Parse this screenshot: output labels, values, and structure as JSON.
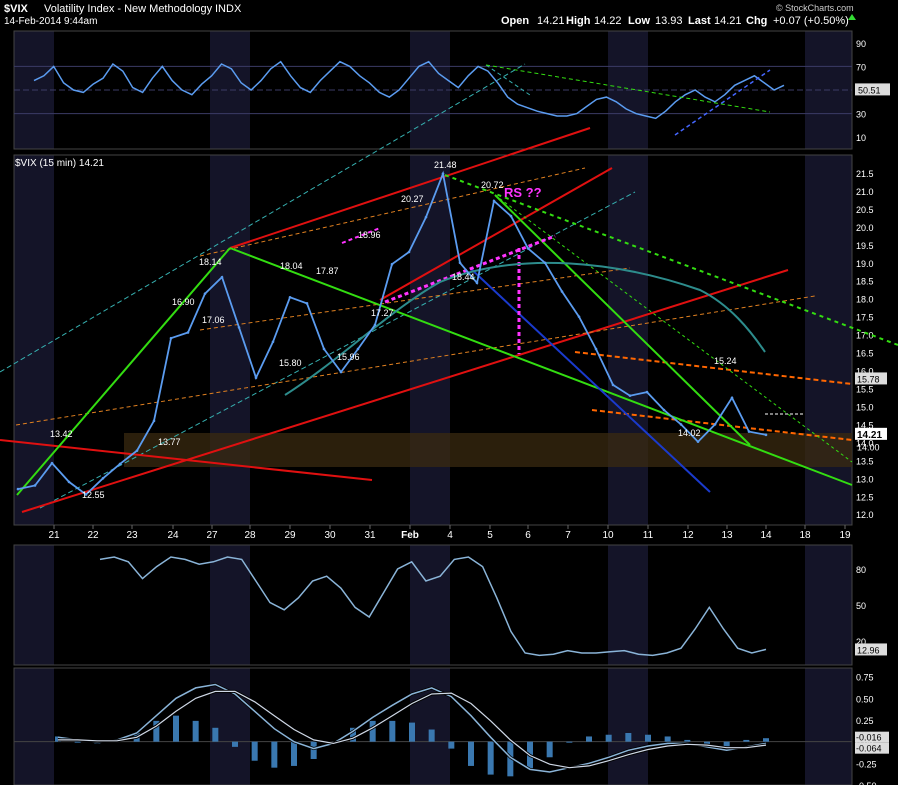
{
  "header": {
    "symbol": "$VIX",
    "name": "Volatility Index - New Methodology",
    "exchange": "INDX",
    "timestamp": "14-Feb-2014 9:44am",
    "open_label": "Open",
    "open": "14.21",
    "high_label": "High",
    "high": "14.22",
    "low_label": "Low",
    "low": "13.93",
    "last_label": "Last",
    "last": "14.21",
    "chg_label": "Chg",
    "chg": "+0.07 (+0.50%)",
    "watermark": "© StockCharts.com"
  },
  "colors": {
    "background": "#000000",
    "band": "#141428",
    "price": "#5b9cf0",
    "teal": "#36b0b0",
    "red": "#e01010",
    "green": "#33dd11",
    "orange": "#e08020",
    "magenta": "#ff33ff",
    "blue": "#1a3acc"
  },
  "chart_data": [
    {
      "type": "line",
      "panel": "indicator-top",
      "ylim": [
        0,
        100
      ],
      "y_ticks": [
        "90",
        "70",
        "50",
        "30",
        "10"
      ],
      "reference_lines": [
        70,
        50,
        30
      ],
      "current_label": "50.51",
      "current_value": 50.51,
      "series": [
        {
          "values": [
            58,
            62,
            70,
            56,
            50,
            48,
            55,
            60,
            72,
            66,
            52,
            48,
            60,
            70,
            58,
            50,
            46,
            55,
            62,
            72,
            68,
            56,
            50,
            58,
            68,
            74,
            62,
            52,
            48,
            58,
            66,
            74,
            70,
            62,
            56,
            48,
            44,
            50,
            60,
            70,
            74,
            64,
            58,
            52,
            62,
            70,
            66,
            56,
            44,
            38,
            35,
            32,
            30,
            28,
            28,
            30,
            36,
            42,
            44,
            40,
            34,
            30,
            28,
            26,
            32,
            40,
            46,
            50,
            44,
            40,
            46,
            54,
            58,
            62,
            56,
            50,
            54
          ]
        }
      ]
    },
    {
      "type": "line",
      "panel": "price",
      "title": "$VIX (15 min) 14.21",
      "ylim": [
        11.7,
        22.0
      ],
      "y_ticks": [
        "21.5",
        "21.0",
        "20.5",
        "20.0",
        "19.5",
        "19.0",
        "18.5",
        "18.0",
        "17.5",
        "17.0",
        "16.5",
        "16.0",
        "15.5",
        "15.0",
        "14.5",
        "14.0",
        "13.5",
        "13.0",
        "12.5",
        "12.0"
      ],
      "x_ticks": [
        "21",
        "22",
        "23",
        "24",
        "27",
        "28",
        "29",
        "30",
        "31",
        "Feb",
        "4",
        "5",
        "6",
        "7",
        "10",
        "11",
        "12",
        "13",
        "14",
        "18",
        "19"
      ],
      "last_label": "14.21",
      "extra_labels": [
        "15.78",
        "14.00"
      ],
      "series": [
        {
          "name": "$VIX",
          "x": [
            0,
            0.5,
            1,
            1.5,
            2,
            2.5,
            3,
            3.5,
            4,
            4.5,
            5,
            5.5,
            6,
            6.5,
            7,
            7.5,
            8,
            8.5,
            9,
            9.5,
            10,
            10.5,
            11,
            11.5,
            12,
            12.5,
            13,
            13.5,
            14,
            14.5,
            15,
            15.5,
            16,
            16.5,
            17,
            17.5,
            18,
            18.5,
            19,
            19.5,
            20,
            20.5,
            21,
            21.5,
            22
          ],
          "values": [
            12.7,
            12.8,
            13.42,
            12.9,
            12.55,
            13.0,
            13.4,
            13.77,
            14.6,
            16.9,
            17.06,
            18.14,
            18.6,
            17.2,
            15.8,
            16.8,
            18.04,
            17.87,
            16.6,
            15.96,
            16.6,
            17.27,
            18.96,
            19.3,
            20.27,
            21.48,
            19.0,
            18.44,
            20.72,
            20.3,
            19.4,
            19.0,
            18.2,
            17.5,
            16.6,
            15.6,
            15.3,
            15.4,
            14.9,
            14.5,
            14.02,
            14.5,
            15.24,
            14.3,
            14.21
          ]
        }
      ],
      "annotations": [
        "RS ??",
        "18.96",
        "21.48",
        "20.72",
        "20.27",
        "18.44",
        "17.27",
        "15.96",
        "15.80",
        "17.87",
        "18.04",
        "18.14",
        "17.06",
        "16.90",
        "13.42",
        "12.55",
        "13.77",
        "14.02",
        "15.24"
      ]
    },
    {
      "type": "line",
      "panel": "indicator-middle",
      "ylim": [
        0,
        100
      ],
      "y_ticks": [
        "80",
        "50",
        "20"
      ],
      "current_label": "12.96",
      "series": [
        {
          "values": [
            88,
            90,
            86,
            72,
            82,
            90,
            88,
            84,
            86,
            90,
            88,
            70,
            52,
            46,
            56,
            70,
            74,
            64,
            48,
            40,
            60,
            80,
            86,
            70,
            74,
            88,
            90,
            82,
            56,
            28,
            10,
            8,
            9,
            12,
            10,
            10,
            11,
            12,
            9,
            8,
            10,
            14,
            30,
            48,
            30,
            14,
            10,
            13
          ]
        }
      ]
    },
    {
      "type": "line",
      "panel": "indicator-bottom",
      "ylim": [
        -0.5,
        0.85
      ],
      "y_ticks": [
        "0.75",
        "0.50",
        "0.25",
        "0.00",
        "-0.25",
        "-0.50"
      ],
      "current_labels": [
        "-0.016",
        "-0.064"
      ],
      "series": [
        {
          "values": [
            0.05,
            0.02,
            0.0,
            0.02,
            0.1,
            0.3,
            0.5,
            0.62,
            0.66,
            0.55,
            0.35,
            0.15,
            0.0,
            -0.08,
            -0.02,
            0.12,
            0.28,
            0.42,
            0.55,
            0.62,
            0.52,
            0.3,
            0.05,
            -0.18,
            -0.32,
            -0.35,
            -0.3,
            -0.25,
            -0.18,
            -0.1,
            -0.05,
            -0.02,
            -0.02,
            -0.06,
            -0.1,
            -0.06,
            -0.02
          ]
        },
        {
          "values": [
            0.02,
            0.02,
            0.01,
            0.01,
            0.05,
            0.18,
            0.35,
            0.5,
            0.58,
            0.58,
            0.46,
            0.3,
            0.14,
            0.02,
            -0.02,
            0.04,
            0.16,
            0.3,
            0.44,
            0.55,
            0.56,
            0.44,
            0.24,
            0.02,
            -0.16,
            -0.26,
            -0.3,
            -0.28,
            -0.22,
            -0.15,
            -0.09,
            -0.05,
            -0.03,
            -0.04,
            -0.07,
            -0.07,
            -0.04
          ]
        }
      ]
    }
  ]
}
